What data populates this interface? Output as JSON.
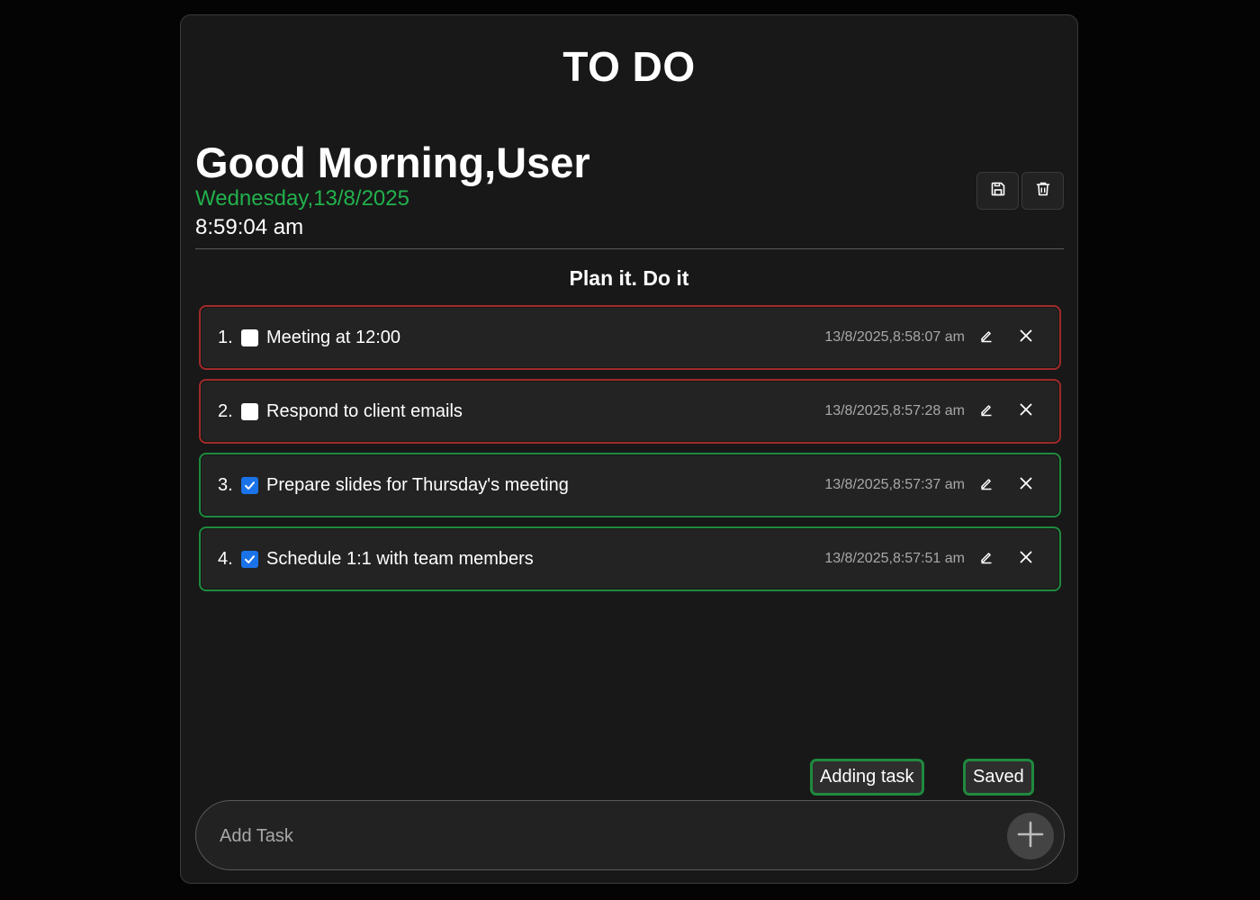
{
  "app": {
    "title": "TO DO"
  },
  "header": {
    "greeting": "Good Morning,User",
    "date": "Wednesday,13/8/2025",
    "time": "8:59:04 am",
    "actions": [
      {
        "icon": "save-icon"
      },
      {
        "icon": "trash-icon"
      }
    ]
  },
  "subtitle": "Plan it. Do it",
  "tasks": [
    {
      "number": "1.",
      "text": "Meeting at 12:00",
      "timestamp": "13/8/2025,8:58:07 am",
      "done": false
    },
    {
      "number": "2.",
      "text": "Respond to client emails",
      "timestamp": "13/8/2025,8:57:28 am",
      "done": false
    },
    {
      "number": "3.",
      "text": "Prepare slides for Thursday's meeting",
      "timestamp": "13/8/2025,8:57:37 am",
      "done": true
    },
    {
      "number": "4.",
      "text": "Schedule 1:1 with team members",
      "timestamp": "13/8/2025,8:57:51 am",
      "done": true
    }
  ],
  "status": {
    "adding": "Adding task",
    "saved": "Saved"
  },
  "add_task": {
    "placeholder": "Add Task",
    "value": "",
    "button_icon": "plus-icon"
  },
  "colors": {
    "date_green": "#22b14c",
    "pending_border": "#a02a2a",
    "done_border": "#1f8a3f",
    "checkbox_blue": "#1a73e8"
  }
}
